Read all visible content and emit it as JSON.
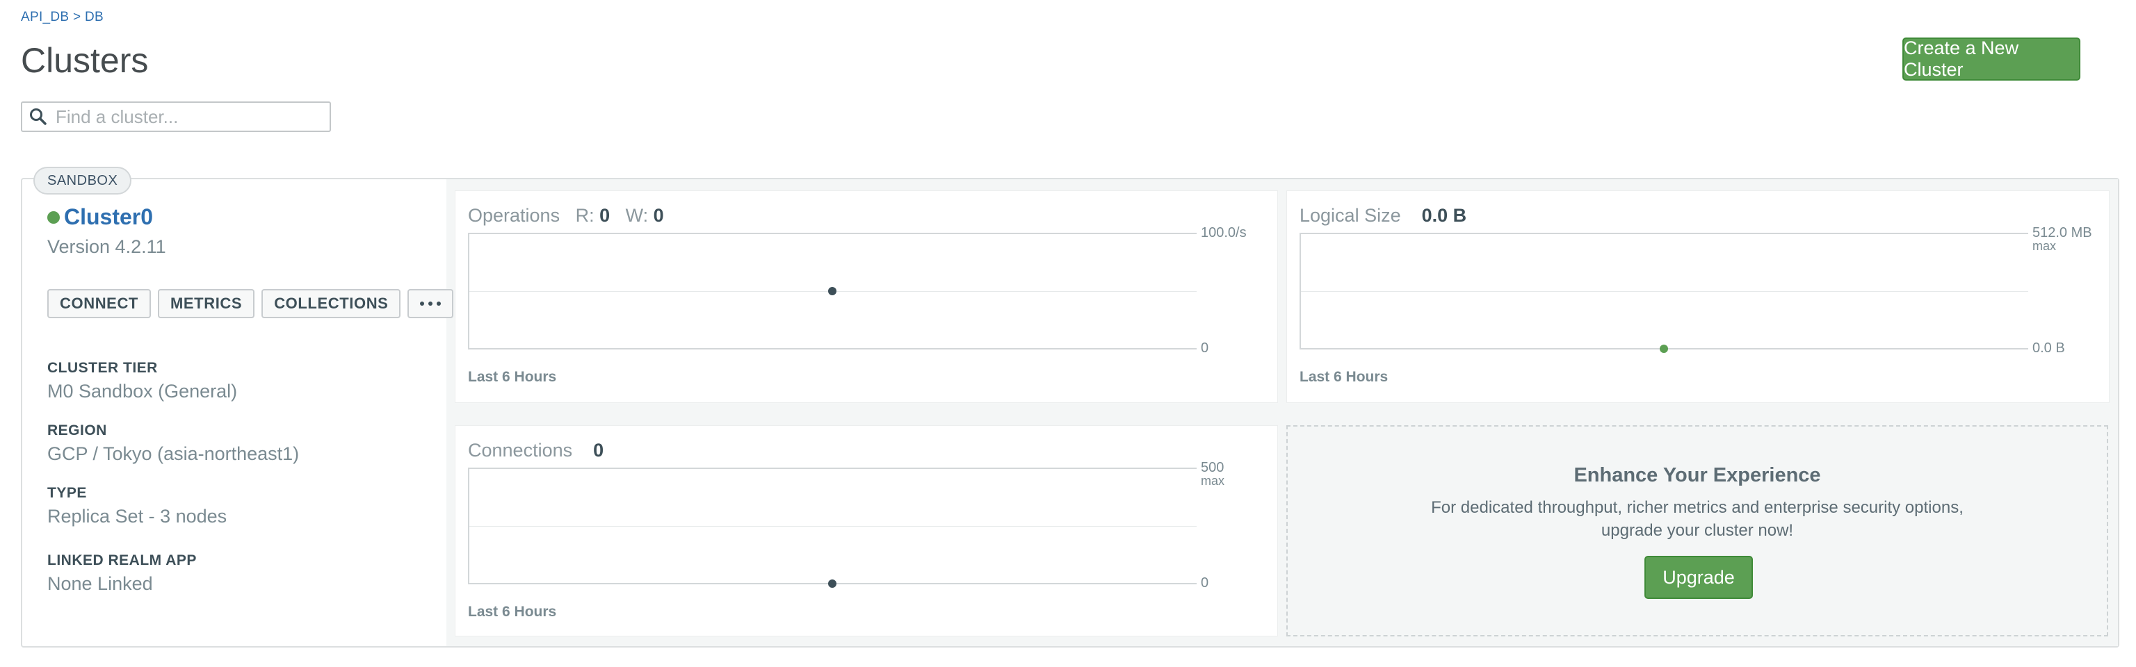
{
  "breadcrumb": "API_DB > DB",
  "page_title": "Clusters",
  "create_button": "Create a New Cluster",
  "search": {
    "placeholder": "Find a cluster...",
    "value": ""
  },
  "cluster": {
    "badge": "SANDBOX",
    "name": "Cluster0",
    "status_color": "#5c9f53",
    "version": "Version 4.2.11",
    "buttons": {
      "connect": "CONNECT",
      "metrics": "METRICS",
      "collections": "COLLECTIONS",
      "more": "..."
    },
    "details": [
      {
        "label": "CLUSTER TIER",
        "value": "M0 Sandbox (General)"
      },
      {
        "label": "REGION",
        "value": "GCP / Tokyo (asia-northeast1)"
      },
      {
        "label": "TYPE",
        "value": "Replica Set - 3 nodes"
      },
      {
        "label": "LINKED REALM APP",
        "value": "None Linked"
      }
    ]
  },
  "charts": {
    "operations": {
      "title": "Operations",
      "r_label": "R:",
      "r_value": "0",
      "w_label": "W:",
      "w_value": "0",
      "max_label": "100.0/s",
      "min_label": "0",
      "footer": "Last 6 Hours"
    },
    "logical_size": {
      "title": "Logical Size",
      "value": "0.0 B",
      "max_label": "512.0 MB",
      "max_sub": "max",
      "min_label": "0.0 B",
      "footer": "Last 6 Hours"
    },
    "connections": {
      "title": "Connections",
      "value": "0",
      "max_label": "500",
      "max_sub": "max",
      "min_label": "0",
      "footer": "Last 6 Hours"
    }
  },
  "upgrade": {
    "title": "Enhance Your Experience",
    "line1": "For dedicated throughput, richer metrics and enterprise security options,",
    "line2": "upgrade your cluster now!",
    "button": "Upgrade"
  },
  "colors": {
    "accent_green": "#5c9f53",
    "link_blue": "#2e6fb0"
  }
}
